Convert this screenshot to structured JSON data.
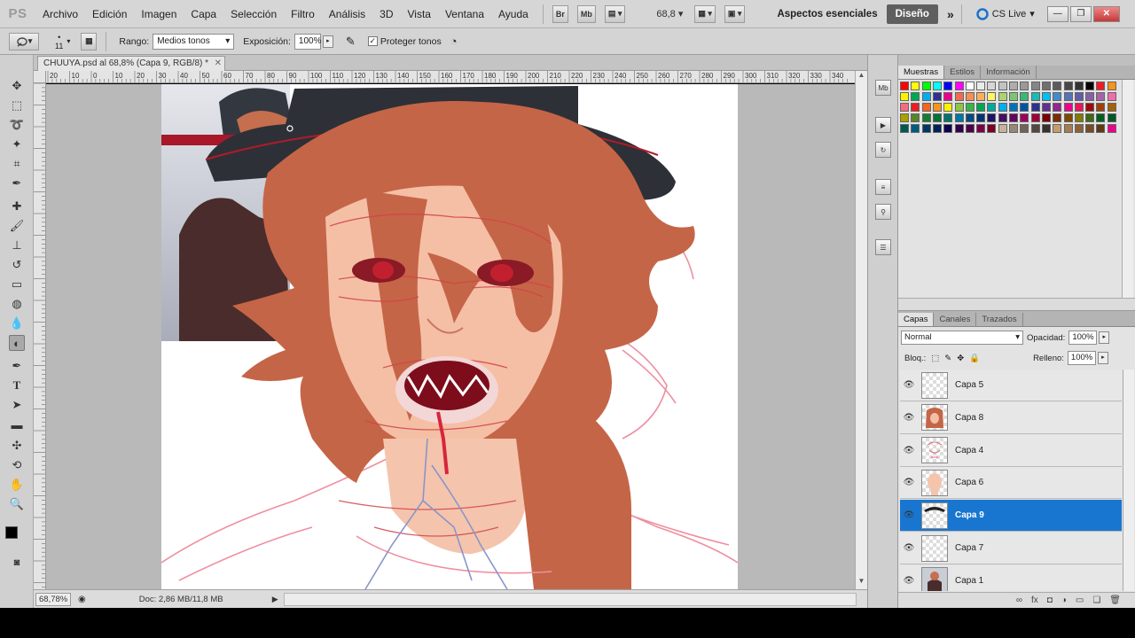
{
  "app": {
    "logo": "PS"
  },
  "menu": [
    "Archivo",
    "Edición",
    "Imagen",
    "Capa",
    "Selección",
    "Filtro",
    "Análisis",
    "3D",
    "Vista",
    "Ventana",
    "Ayuda"
  ],
  "toolbar": {
    "br": "Br",
    "mb": "Mb",
    "zoom": "68,8",
    "workspace": "Aspectos esenciales",
    "design": "Diseño",
    "cslive": "CS Live"
  },
  "options": {
    "brush_size": "11",
    "range_label": "Rango:",
    "range_value": "Medios tonos",
    "exposure_label": "Exposición:",
    "exposure_value": "100%",
    "protect_label": "Proteger tonos",
    "protect_checked": true
  },
  "document": {
    "tab_title": "CHUUYA.psd al 68,8% (Capa 9, RGB/8) *",
    "zoom": "68,78%",
    "doc_size": "Doc: 2,86 MB/11,8 MB",
    "ruler_ticks": [
      "20",
      "10",
      "0",
      "10",
      "20",
      "30",
      "40",
      "50",
      "60",
      "70",
      "80",
      "90",
      "100",
      "110",
      "120",
      "130",
      "140",
      "150",
      "160",
      "170",
      "180",
      "190",
      "200",
      "210",
      "220",
      "230",
      "240",
      "250",
      "260",
      "270",
      "280",
      "290",
      "300",
      "310",
      "320",
      "330",
      "340"
    ]
  },
  "swatches_panel": {
    "tabs": [
      "Muestras",
      "Estilos",
      "Información"
    ],
    "colors": [
      "#ff0000",
      "#ffff00",
      "#00ff00",
      "#00ffff",
      "#0000ff",
      "#ff00ff",
      "#ffffff",
      "#ebebeb",
      "#d6d6d6",
      "#c2c2c2",
      "#adadad",
      "#999999",
      "#858585",
      "#707070",
      "#5c5c5c",
      "#474747",
      "#333333",
      "#000000",
      "#ed1c24",
      "#f7941d",
      "#fff200",
      "#00a651",
      "#00aeef",
      "#2e3192",
      "#ec008c",
      "#f26c4f",
      "#f68e55",
      "#fbaf5c",
      "#fff467",
      "#acd372",
      "#7cc576",
      "#3bb878",
      "#1abbb4",
      "#00bff3",
      "#438ccb",
      "#5574b9",
      "#605ca8",
      "#855fa8",
      "#a763a8",
      "#f06ea9",
      "#f26d7d",
      "#ed1c24",
      "#f26522",
      "#f7941d",
      "#fff200",
      "#8dc63f",
      "#39b54a",
      "#00a651",
      "#00a99d",
      "#00aeef",
      "#0072bc",
      "#0054a6",
      "#2e3192",
      "#662d91",
      "#92278f",
      "#ec008c",
      "#ed145b",
      "#9e0b0f",
      "#a0410d",
      "#a3620a",
      "#aba000",
      "#598527",
      "#197b30",
      "#007236",
      "#00746b",
      "#0076a3",
      "#004b80",
      "#003471",
      "#1b1464",
      "#440e62",
      "#630460",
      "#9e005d",
      "#9e0039",
      "#790000",
      "#7b2e00",
      "#7d4900",
      "#827b00",
      "#406618",
      "#005e20",
      "#005826",
      "#005952",
      "#005b7f",
      "#003663",
      "#002157",
      "#0d004c",
      "#32004b",
      "#4b0049",
      "#7b0046",
      "#7a0026",
      "#c7b299",
      "#998675",
      "#736357",
      "#534741",
      "#37302d",
      "#c69c6d",
      "#a67c52",
      "#8c6239",
      "#754c24",
      "#603913",
      "#ec008c"
    ],
    "color_count_note": "palette"
  },
  "layers_panel": {
    "tabs": [
      "Capas",
      "Canales",
      "Trazados"
    ],
    "blend_mode": "Normal",
    "opacity_label": "Opacidad:",
    "opacity": "100%",
    "lock_label": "Bloq.:",
    "fill_label": "Relleno:",
    "fill": "100%",
    "layers": [
      {
        "name": "Capa 5",
        "selected": false,
        "thumb": "blank"
      },
      {
        "name": "Capa 8",
        "selected": false,
        "thumb": "hair"
      },
      {
        "name": "Capa 4",
        "selected": false,
        "thumb": "sketch"
      },
      {
        "name": "Capa 6",
        "selected": false,
        "thumb": "skin"
      },
      {
        "name": "Capa 9",
        "selected": true,
        "thumb": "hat"
      },
      {
        "name": "Capa 7",
        "selected": false,
        "thumb": "blank"
      },
      {
        "name": "Capa 1",
        "selected": false,
        "thumb": "ref"
      }
    ]
  }
}
